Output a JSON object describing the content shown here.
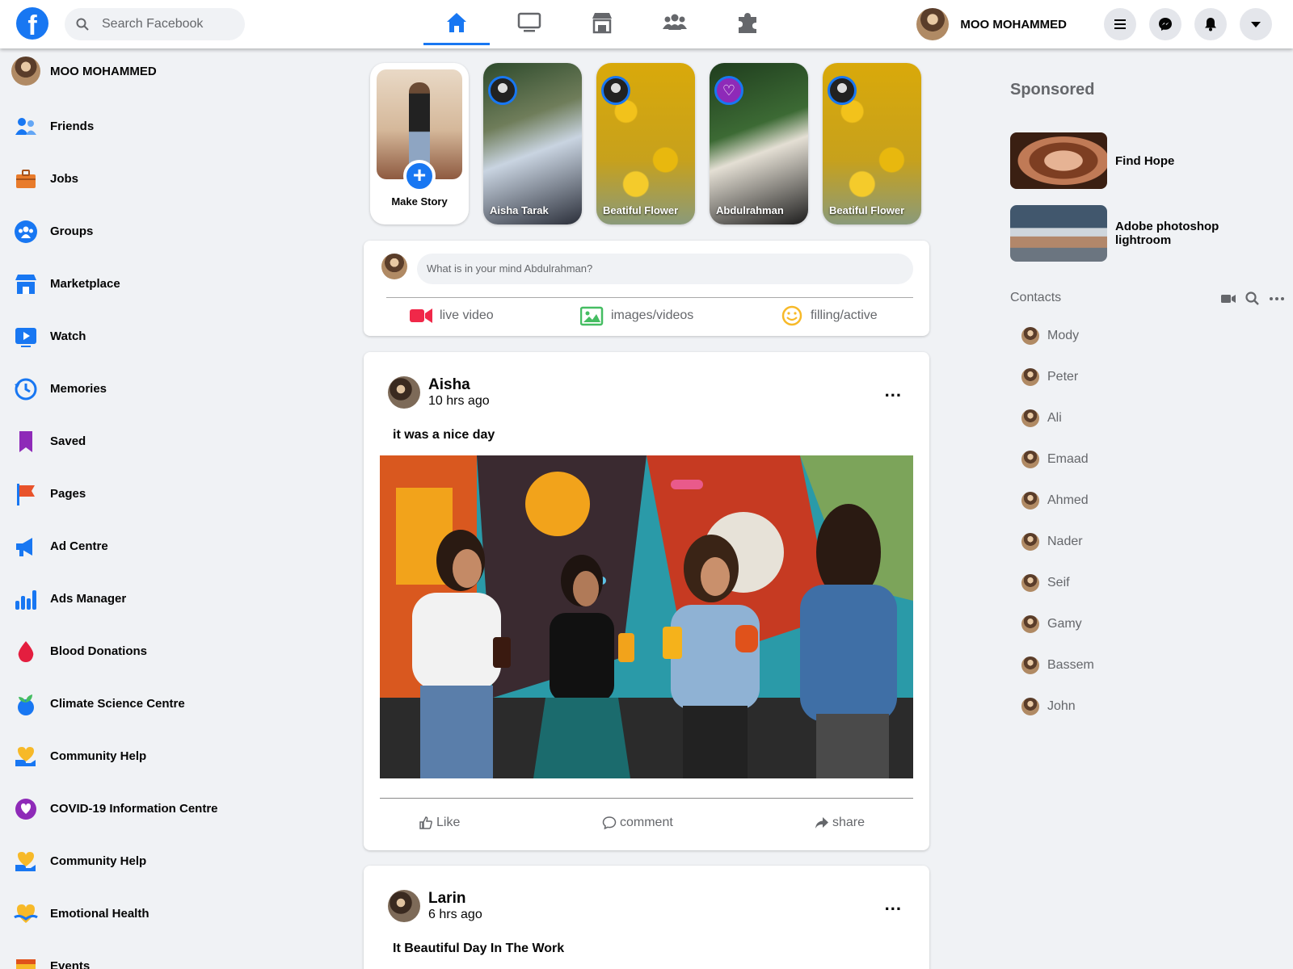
{
  "header": {
    "logo": "f",
    "search_placeholder": "Search Facebook",
    "user_name": "MOO MOHAMMED"
  },
  "sidebar": {
    "profile_name": "MOO MOHAMMED",
    "items": [
      {
        "label": "Friends",
        "icon": "friends-icon",
        "color": "#1877f2"
      },
      {
        "label": "Jobs",
        "icon": "jobs-icon",
        "color": "#e87b2b"
      },
      {
        "label": "Groups",
        "icon": "groups-icon",
        "color": "#1877f2"
      },
      {
        "label": "Marketplace",
        "icon": "marketplace-icon",
        "color": "#1877f2"
      },
      {
        "label": "Watch",
        "icon": "watch-icon",
        "color": "#1877f2"
      },
      {
        "label": "Memories",
        "icon": "memories-icon",
        "color": "#1877f2"
      },
      {
        "label": "Saved",
        "icon": "saved-icon",
        "color": "#8e2ab8"
      },
      {
        "label": "Pages",
        "icon": "pages-icon",
        "color": "#e8532b"
      },
      {
        "label": "Ad Centre",
        "icon": "ad-centre-icon",
        "color": "#1877f2"
      },
      {
        "label": "Ads Manager",
        "icon": "ads-manager-icon",
        "color": "#1877f2"
      },
      {
        "label": "Blood Donations",
        "icon": "blood-donations-icon",
        "color": "#e41e3f"
      },
      {
        "label": "Climate Science Centre",
        "icon": "climate-icon",
        "color": "#1877f2"
      },
      {
        "label": "Community Help",
        "icon": "community-help-icon",
        "color": "#f7b928"
      },
      {
        "label": "COVID-19 Information Centre",
        "icon": "covid-icon",
        "color": "#8e2ab8"
      },
      {
        "label": "Community Help",
        "icon": "community-help-icon",
        "color": "#f7b928"
      },
      {
        "label": "Emotional Health",
        "icon": "emotional-health-icon",
        "color": "#f7b928"
      },
      {
        "label": "Events",
        "icon": "events-icon",
        "color": "#f7b928"
      }
    ]
  },
  "stories": {
    "make_label": "Make Story",
    "items": [
      {
        "name": "Aisha Tarak"
      },
      {
        "name": "Beatiful Flower"
      },
      {
        "name": "Abdulrahman"
      },
      {
        "name": "Beatiful Flower"
      }
    ]
  },
  "composer": {
    "placeholder": "What is in your mind Abdulrahman?",
    "actions": [
      "live video",
      "images/videos",
      "filling/active"
    ]
  },
  "posts": [
    {
      "author": "Aisha",
      "time": "10 hrs ago",
      "text": "it was a nice day",
      "actions": [
        "Like",
        "comment",
        "share"
      ]
    },
    {
      "author": "Larin",
      "time": "6 hrs ago",
      "text": "It Beautiful Day In The Work"
    }
  ],
  "right": {
    "sponsored_title": "Sponsored",
    "ads": [
      {
        "title": "Find Hope"
      },
      {
        "title": "Adobe photoshop lightroom"
      }
    ],
    "contacts_title": "Contacts",
    "contacts": [
      "Mody",
      "Peter",
      "Ali",
      "Emaad",
      "Ahmed",
      "Nader",
      "Seif",
      "Gamy",
      "Bassem",
      "John"
    ]
  },
  "colors": {
    "brand": "#1877f2",
    "background": "#f0f2f5",
    "secondary_text": "#65676b"
  }
}
